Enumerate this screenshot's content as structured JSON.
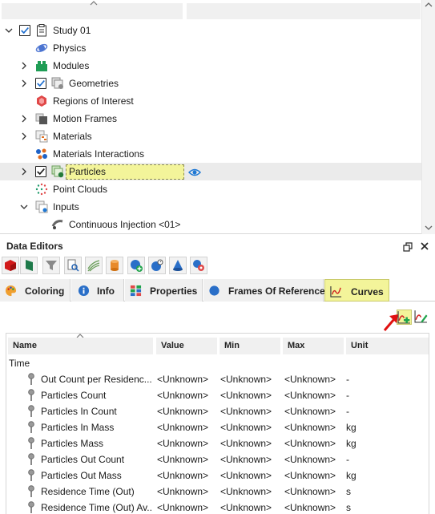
{
  "tree": {
    "items": [
      {
        "label": "Study 01"
      },
      {
        "label": "Physics"
      },
      {
        "label": "Modules"
      },
      {
        "label": "Geometries"
      },
      {
        "label": "Regions of Interest"
      },
      {
        "label": "Motion Frames"
      },
      {
        "label": "Materials"
      },
      {
        "label": "Materials Interactions"
      },
      {
        "label": "Particles"
      },
      {
        "label": "Point Clouds"
      },
      {
        "label": "Inputs"
      },
      {
        "label": "Continuous Injection <01>"
      }
    ]
  },
  "data_editors": {
    "title": "Data Editors",
    "toolbar_icons": [
      "red-cube-icon",
      "green-flag-icon",
      "funnel-icon",
      "search-doc-icon",
      "lines-icon",
      "cylinder-icon",
      "add-circle-icon",
      "gauge-icon",
      "cone-icon",
      "particles-icon"
    ],
    "tabs": [
      {
        "label": "Coloring",
        "icon": "palette-icon"
      },
      {
        "label": "Info",
        "icon": "info-icon"
      },
      {
        "label": "Properties",
        "icon": "properties-icon"
      },
      {
        "label": "Frames Of Reference",
        "icon": "blue-circle-icon"
      },
      {
        "label": "Curves",
        "icon": "curve-chart-icon",
        "active": true
      }
    ]
  },
  "curves_table": {
    "columns": [
      "Name",
      "Value",
      "Min",
      "Max",
      "Unit"
    ],
    "group": "Time",
    "rows": [
      {
        "name": "Out Count per Residenc...",
        "value": "<Unknown>",
        "min": "<Unknown>",
        "max": "<Unknown>",
        "unit": "-"
      },
      {
        "name": "Particles Count",
        "value": "<Unknown>",
        "min": "<Unknown>",
        "max": "<Unknown>",
        "unit": "-"
      },
      {
        "name": "Particles In Count",
        "value": "<Unknown>",
        "min": "<Unknown>",
        "max": "<Unknown>",
        "unit": "-"
      },
      {
        "name": "Particles In Mass",
        "value": "<Unknown>",
        "min": "<Unknown>",
        "max": "<Unknown>",
        "unit": "kg"
      },
      {
        "name": "Particles Mass",
        "value": "<Unknown>",
        "min": "<Unknown>",
        "max": "<Unknown>",
        "unit": "kg"
      },
      {
        "name": "Particles Out Count",
        "value": "<Unknown>",
        "min": "<Unknown>",
        "max": "<Unknown>",
        "unit": "-"
      },
      {
        "name": "Particles Out Mass",
        "value": "<Unknown>",
        "min": "<Unknown>",
        "max": "<Unknown>",
        "unit": "kg"
      },
      {
        "name": "Residence Time (Out)",
        "value": "<Unknown>",
        "min": "<Unknown>",
        "max": "<Unknown>",
        "unit": "s"
      },
      {
        "name": "Residence Time (Out) Av...",
        "value": "<Unknown>",
        "min": "<Unknown>",
        "max": "<Unknown>",
        "unit": "s"
      }
    ]
  },
  "colors": {
    "highlight": "#f3f49a",
    "accent_blue": "#1e78d4",
    "arrow_red": "#e01010"
  }
}
